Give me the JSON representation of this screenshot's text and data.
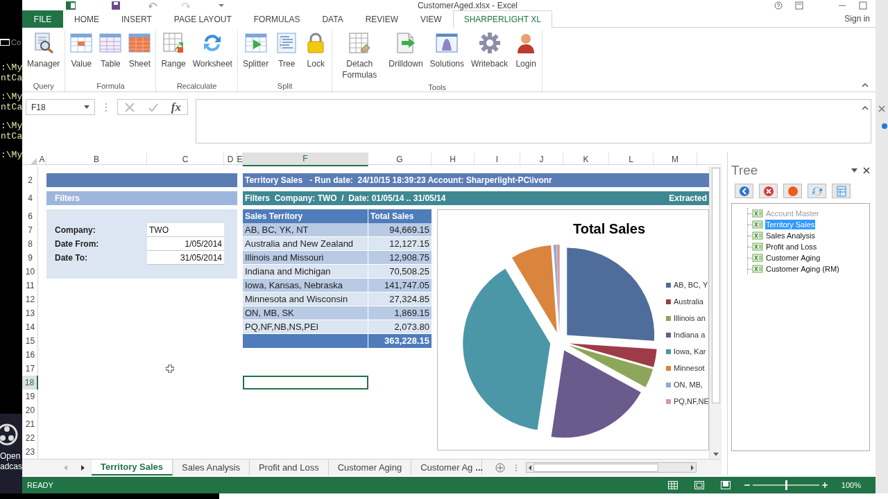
{
  "desktop": {
    "console_title": "Co",
    "console_groups": [
      [
        ":\\My",
        "ntCa"
      ],
      [
        ":\\My",
        "ntCa"
      ],
      [
        ":\\My",
        "ntCa"
      ],
      [
        ":\\My"
      ]
    ],
    "app_caption": [
      "Open",
      "adcas"
    ]
  },
  "window": {
    "title": "CustomerAged.xlsx - Excel",
    "sign_in": "Sign in"
  },
  "ribbon_tabs": [
    {
      "label": "FILE",
      "kind": "file",
      "selected": false
    },
    {
      "label": "HOME",
      "kind": "tab",
      "selected": false
    },
    {
      "label": "INSERT",
      "kind": "tab",
      "selected": false
    },
    {
      "label": "PAGE LAYOUT",
      "kind": "tab",
      "selected": false
    },
    {
      "label": "FORMULAS",
      "kind": "tab",
      "selected": false
    },
    {
      "label": "DATA",
      "kind": "tab",
      "selected": false
    },
    {
      "label": "REVIEW",
      "kind": "tab",
      "selected": false
    },
    {
      "label": "VIEW",
      "kind": "tab",
      "selected": false
    },
    {
      "label": "SHARPERLIGHT XL",
      "kind": "tab",
      "selected": true
    }
  ],
  "ribbon_groups": [
    {
      "label": "Query",
      "buttons": [
        "Manager"
      ]
    },
    {
      "label": "Formula",
      "buttons": [
        "Value",
        "Table",
        "Sheet"
      ]
    },
    {
      "label": "Recalculate",
      "buttons": [
        "Range",
        "Worksheet"
      ]
    },
    {
      "label": "Split",
      "buttons": [
        "Splitter",
        "Tree",
        "Lock"
      ]
    },
    {
      "label": "Tools",
      "buttons": [
        "Detach Formulas",
        "Drilldown",
        "Solutions",
        "Writeback",
        "Login"
      ]
    }
  ],
  "formula_bar": {
    "name_box": "F18",
    "function_label": "fx"
  },
  "sheet": {
    "columns": [
      {
        "label": "A",
        "selected": false
      },
      {
        "label": "B",
        "selected": false
      },
      {
        "label": "C",
        "selected": false
      },
      {
        "label": "D",
        "selected": false
      },
      {
        "label": "E",
        "selected": false
      },
      {
        "label": "F",
        "selected": true
      },
      {
        "label": "G",
        "selected": false
      },
      {
        "label": "H",
        "selected": false
      },
      {
        "label": "I",
        "selected": false
      },
      {
        "label": "J",
        "selected": false
      },
      {
        "label": "K",
        "selected": false
      },
      {
        "label": "L",
        "selected": false
      },
      {
        "label": "M",
        "selected": false
      }
    ],
    "rows": [
      {
        "label": "2",
        "selected": false
      },
      {
        "label": "4",
        "selected": false
      },
      {
        "label": "6",
        "selected": false
      },
      {
        "label": "7",
        "selected": false
      },
      {
        "label": "8",
        "selected": false
      },
      {
        "label": "9",
        "selected": false
      },
      {
        "label": "10",
        "selected": false
      },
      {
        "label": "11",
        "selected": false
      },
      {
        "label": "12",
        "selected": false
      },
      {
        "label": "13",
        "selected": false
      },
      {
        "label": "14",
        "selected": false
      },
      {
        "label": "15",
        "selected": false
      },
      {
        "label": "16",
        "selected": false
      },
      {
        "label": "17",
        "selected": false
      },
      {
        "label": "18",
        "selected": true
      },
      {
        "label": "19",
        "selected": false
      },
      {
        "label": "20",
        "selected": false
      },
      {
        "label": "21",
        "selected": false
      },
      {
        "label": "22",
        "selected": false
      },
      {
        "label": "23",
        "selected": false
      }
    ],
    "report_title": "Territory Sales   - Run date:  24/10/15 18:39:23 Account: Sharperlight-PC\\ivonr",
    "filters_label": "Filters",
    "filter_summary": "Filters  Company: TWO  /  Date: 01/05/14 .. 31/05/14",
    "extracted": "Extracted",
    "parameters": [
      {
        "label": "Company:",
        "value": "TWO",
        "kind": "text"
      },
      {
        "label": "Date From:",
        "value": "1/05/2014",
        "kind": "date"
      },
      {
        "label": "Date To:",
        "value": "31/05/2014",
        "kind": "date"
      }
    ],
    "table": {
      "columns": [
        "Sales Territory",
        "Total Sales"
      ],
      "rows": [
        {
          "territory": "AB, BC, YK, NT",
          "total": "94,669.15"
        },
        {
          "territory": "Australia and New Zealand",
          "total": "12,127.15"
        },
        {
          "territory": "Illinois and Missouri",
          "total": "12,908.75"
        },
        {
          "territory": "Indiana and Michigan",
          "total": "70,508.25"
        },
        {
          "territory": "Iowa, Kansas, Nebraska",
          "total": "141,747.05"
        },
        {
          "territory": "Minnesota and Wisconsin",
          "total": "27,324.85"
        },
        {
          "territory": "ON, MB, SK",
          "total": "1,869.15"
        },
        {
          "territory": "PQ,NF,NB,NS,PEI",
          "total": "2,073.80"
        }
      ],
      "grand_total": "363,228.15"
    },
    "chart": {
      "title": "Total Sales",
      "legend": [
        {
          "label": "AB, BC, Y",
          "color": "#4f6d9a"
        },
        {
          "label": "Australia",
          "color": "#9e3b48"
        },
        {
          "label": "Illinois an",
          "color": "#8ea65a"
        },
        {
          "label": "Indiana a",
          "color": "#6b5a8c"
        },
        {
          "label": "Iowa, Kar",
          "color": "#4b97a8"
        },
        {
          "label": "Minnesot",
          "color": "#d9853e"
        },
        {
          "label": "ON, MB,",
          "color": "#93a9cf"
        },
        {
          "label": "PQ,NF,NE",
          "color": "#d79a9c"
        }
      ]
    }
  },
  "tree_pane": {
    "title": "Tree",
    "items": [
      {
        "label": "Account Master",
        "disabled": true,
        "selected": false
      },
      {
        "label": "Territory Sales",
        "disabled": false,
        "selected": true
      },
      {
        "label": "Sales Analysis",
        "disabled": false,
        "selected": false
      },
      {
        "label": "Profit and Loss",
        "disabled": false,
        "selected": false
      },
      {
        "label": "Customer Aging",
        "disabled": false,
        "selected": false
      },
      {
        "label": "Customer Aging (RM)",
        "disabled": false,
        "selected": false
      }
    ]
  },
  "sheet_tabs": [
    {
      "label": "Territory Sales",
      "selected": true
    },
    {
      "label": "Sales Analysis",
      "selected": false
    },
    {
      "label": "Profit and Loss",
      "selected": false
    },
    {
      "label": "Customer Aging",
      "selected": false
    },
    {
      "label": "Customer Ag",
      "selected": false
    }
  ],
  "tabs_overflow": "...",
  "status_bar": {
    "status": "READY",
    "zoom_slider": {
      "level": 0.5
    },
    "zoom": "100%"
  }
}
